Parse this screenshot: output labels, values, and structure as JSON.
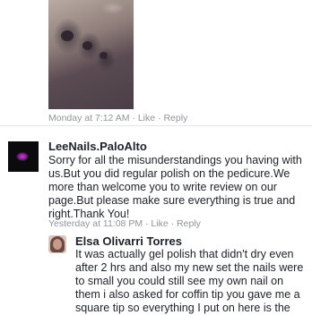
{
  "post": {
    "meta": {
      "time": "Monday at 7:12 AM",
      "separator": " · ",
      "like": "Like",
      "reply": "Reply"
    }
  },
  "comments": [
    {
      "author": "LeeNails.PaloAlto",
      "text": "Sorry for all the misunderstandings you having with us.But you did regular polish on the pedicure.We more than welcome you to write review on our page.But please make sure everything is true and right.Thank You!",
      "time": "Yesterday at 11:08 PM",
      "separator": " · ",
      "like": "Like",
      "reply": "Reply"
    },
    {
      "author": "Elsa Olivarri Torres",
      "text": "It was actually gel polish that didn't dry even after 2 hrs and also my new set the nails were to small you could still see my own nail on them i also asked for coffin tip you gave me a square tip so everything I put on here is the"
    }
  ]
}
